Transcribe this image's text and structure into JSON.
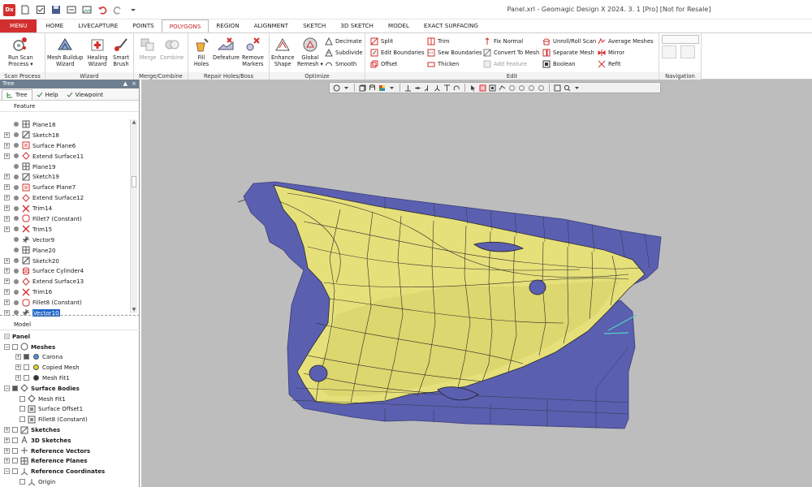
{
  "app": {
    "icon_label": "Dx",
    "window_title": "Panel.xrl - Geomagic Design X 2024. 3. 1 [Pro] [Not for Resale]"
  },
  "tabs": [
    {
      "label": "MENU"
    },
    {
      "label": "HOME"
    },
    {
      "label": "LIVECAPTURE"
    },
    {
      "label": "POINTS"
    },
    {
      "label": "POLYGONS"
    },
    {
      "label": "REGION"
    },
    {
      "label": "ALIGNMENT"
    },
    {
      "label": "SKETCH"
    },
    {
      "label": "3D SKETCH"
    },
    {
      "label": "MODEL"
    },
    {
      "label": "EXACT SURFACING"
    }
  ],
  "active_tab": "POLYGONS",
  "ribbon": {
    "scan_process": {
      "group_label": "Scan Process",
      "run_scan_line1": "Run Scan",
      "run_scan_line2": "Process ▾"
    },
    "wizard": {
      "group_label": "Wizard",
      "mesh_buildup_line1": "Mesh Buildup",
      "mesh_buildup_line2": "Wizard",
      "healing_line1": "Healing",
      "healing_line2": "Wizard",
      "smart_line1": "Smart",
      "smart_line2": "Brush"
    },
    "merge_combine": {
      "group_label": "Merge/Combine",
      "merge": "Merge",
      "combine": "Combine"
    },
    "repair": {
      "group_label": "Repair Holes/Boss",
      "fill_line1": "Fill",
      "fill_line2": "Holes",
      "defeature": "Defeature",
      "remove_line1": "Remove",
      "remove_line2": "Markers"
    },
    "optimize": {
      "group_label": "Optimize",
      "enhance_line1": "Enhance",
      "enhance_line2": "Shape",
      "remesh_line1": "Global",
      "remesh_line2": "Remesh ▾",
      "decimate": "Decimate",
      "subdivide": "Subdivide",
      "smooth": "Smooth"
    },
    "edit": {
      "group_label": "Edit",
      "split": "Split",
      "edit_boundaries": "Edit Boundaries",
      "offset": "Offset",
      "trim": "Trim",
      "sew_boundaries": "Sew Boundaries",
      "thicken": "Thicken",
      "fix_normal": "Fix Normal",
      "convert_to_mesh": "Convert To Mesh",
      "add_feature": "Add Feature",
      "unroll_roll_scan": "Unroll/Roll Scan",
      "separate_mesh": "Separate Mesh",
      "boolean": "Boolean",
      "average_meshes": "Average Meshes",
      "mirror": "Mirror",
      "refit": "Refit"
    },
    "navigation": {
      "group_label": "Navigation"
    }
  },
  "panel": {
    "title": "Tree",
    "tab_tree": "Tree",
    "tab_help": "Help",
    "tab_viewpoint": "Viewpoint",
    "feature_header": "Feature",
    "model_header": "Model"
  },
  "feature_tree": [
    {
      "label": "Plane18",
      "icon": "plane-icon",
      "expand": false
    },
    {
      "label": "Sketch18",
      "icon": "sketch-icon",
      "expand": true
    },
    {
      "label": "Surface Plane6",
      "icon": "surface-plane-icon",
      "expand": true
    },
    {
      "label": "Extend Surface11",
      "icon": "extend-surface-icon",
      "expand": true
    },
    {
      "label": "Plane19",
      "icon": "plane-icon",
      "expand": false
    },
    {
      "label": "Sketch19",
      "icon": "sketch-icon",
      "expand": true
    },
    {
      "label": "Surface Plane7",
      "icon": "surface-plane-icon",
      "expand": true
    },
    {
      "label": "Extend Surface12",
      "icon": "extend-surface-icon",
      "expand": true
    },
    {
      "label": "Trim14",
      "icon": "trim-icon",
      "expand": true
    },
    {
      "label": "Fillet7 (Constant)",
      "icon": "fillet-icon",
      "expand": true
    },
    {
      "label": "Trim15",
      "icon": "trim-icon",
      "expand": true
    },
    {
      "label": "Vector9",
      "icon": "vector-icon",
      "expand": false
    },
    {
      "label": "Plane20",
      "icon": "plane-icon",
      "expand": false
    },
    {
      "label": "Sketch20",
      "icon": "sketch-icon",
      "expand": true
    },
    {
      "label": "Surface Cylinder4",
      "icon": "surface-cylinder-icon",
      "expand": true
    },
    {
      "label": "Extend Surface13",
      "icon": "extend-surface-icon",
      "expand": true
    },
    {
      "label": "Trim16",
      "icon": "trim-icon",
      "expand": true
    },
    {
      "label": "Fillet8 (Constant)",
      "icon": "fillet-icon",
      "expand": true
    },
    {
      "label": "Vector10",
      "icon": "vector-icon",
      "expand": true,
      "selected": true
    }
  ],
  "model_tree": {
    "root": "Panel",
    "meshes": "Meshes",
    "carona": "Carona",
    "copied_mesh": "Copied Mesh",
    "mesh_fit1": "Mesh Fit1",
    "surface_bodies": "Surface Bodies",
    "sb_mesh_fit1": "Mesh Fit1",
    "surface_offset1": "Surface Offset1",
    "fillet8": "Fillet8 (Constant)",
    "sketches": "Sketches",
    "sketches_3d": "3D Sketches",
    "reference_vectors": "Reference Vectors",
    "reference_planes": "Reference Planes",
    "reference_coordinates": "Reference Coordinates",
    "origin": "Origin"
  },
  "colors": {
    "accent": "#d32f2f",
    "viewport_bg": "#bdbdbd",
    "mesh_blue": "#5b5fb0",
    "surface_yellow": "#e6e07a",
    "selection": "#1e66c9",
    "carona_dot": "#4a90d9",
    "copied_dot": "#e8d21a",
    "meshfit_dot": "#333333"
  }
}
